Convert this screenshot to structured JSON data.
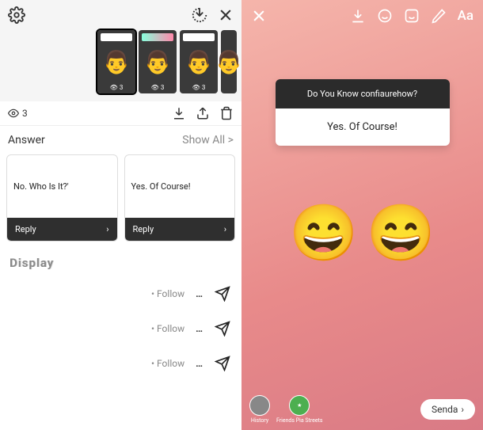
{
  "left": {
    "thumb_views": "3",
    "viewer_count": "3",
    "show_all": "Show All >",
    "answer_label": "Answer",
    "cards": [
      {
        "text": "No. Who Is It?'",
        "reply": "Reply"
      },
      {
        "text": "Yes. Of Course!",
        "reply": "Reply"
      }
    ],
    "display_label": "Display",
    "follow_label": "Follow"
  },
  "right": {
    "poll_question": "Do You Know  confiaurehow?",
    "poll_answer": "Yes. Of Course!",
    "text_tool": "Aa",
    "share1": "History",
    "share2": "Friends Pia Streets",
    "send": "Senda"
  }
}
